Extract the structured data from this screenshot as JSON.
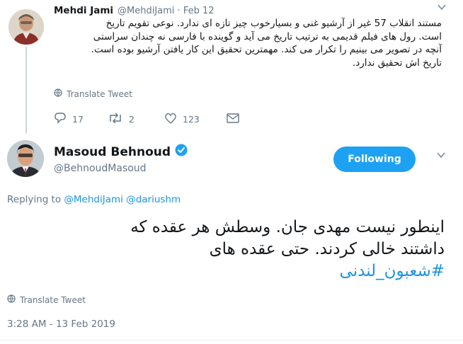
{
  "parent_tweet": {
    "author_name": "Mehdi Jami",
    "author_handle": "@MehdiJami",
    "separator": "·",
    "date": "Feb 12",
    "text_lines": [
      "مستند انقلاب 57 غیر از آرشیو غنی و بسیارخوب چیز تازه ای ندارد. نوعی تقویم تاریخ",
      "است. رول های فیلم قدیمی به ترتیب تاریخ می آید و گوینده با فارسی نه چندان سراستی",
      "آنچه در تصویر می بینیم را تکرار می کند. مهمترین تحقیق این کار یافتن آرشیو بوده است.",
      "تاریخ اش تحقیق ندارد."
    ],
    "translate_label": "Translate Tweet",
    "reply_count": "17",
    "retweet_count": "2",
    "like_count": "123",
    "icons": {
      "chevron": "chevron-down-icon",
      "globe": "globe-icon",
      "reply": "reply-icon",
      "retweet": "retweet-icon",
      "like": "heart-icon",
      "message": "envelope-icon"
    }
  },
  "main_tweet": {
    "author_name": "Masoud Behnoud",
    "author_handle": "@BehnoudMasoud",
    "verified_icon": "verified-badge-icon",
    "follow_button_label": "Following",
    "replying_label": "Replying to",
    "replying_to": [
      "@MehdiJami",
      "@dariushm"
    ],
    "text_lines": [
      "اینطور نیست مهدی جان. وسطش هر عقده که",
      "داشتند خالی کردند. حتی عقده های"
    ],
    "hashtag": "#شعبون_لندنی",
    "translate_label": "Translate Tweet",
    "timestamp": "3:28 AM - 13 Feb 2019"
  },
  "colors": {
    "accent": "#1da1f2",
    "link": "#1b95e0",
    "muted": "#657786",
    "text": "#14171a"
  }
}
